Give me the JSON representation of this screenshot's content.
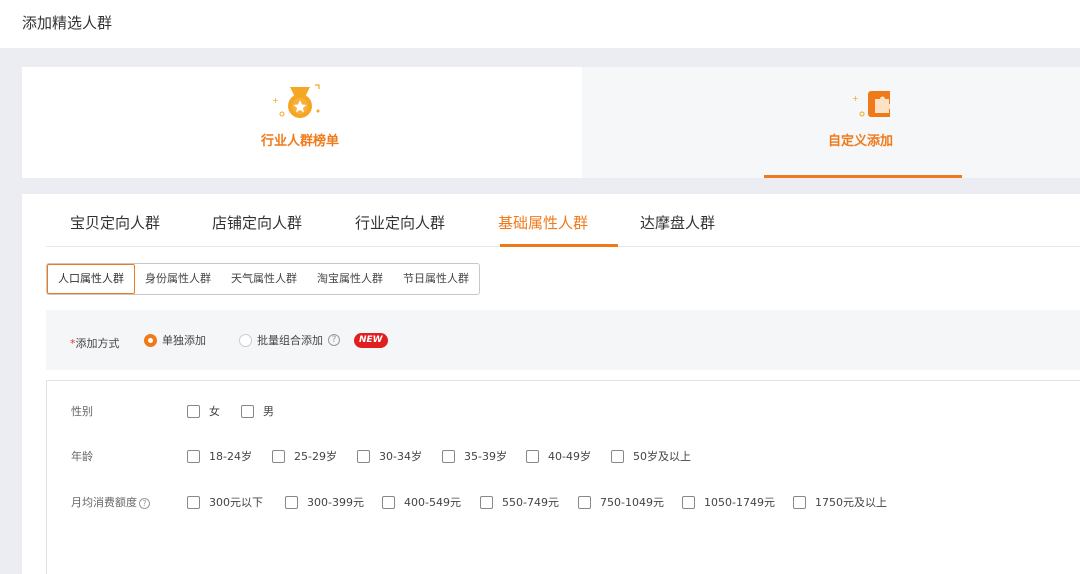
{
  "header": {
    "title": "添加精选人群"
  },
  "modes": [
    {
      "label": "行业人群榜单",
      "icon": "medal-icon"
    },
    {
      "label": "自定义添加",
      "icon": "puzzle-icon",
      "active": true
    }
  ],
  "tabs": [
    "宝贝定向人群",
    "店铺定向人群",
    "行业定向人群",
    "基础属性人群",
    "达摩盘人群"
  ],
  "active_tab": "基础属性人群",
  "subtabs": [
    "人口属性人群",
    "身份属性人群",
    "天气属性人群",
    "淘宝属性人群",
    "节日属性人群"
  ],
  "active_subtab": "人口属性人群",
  "method": {
    "required_mark": "*",
    "label": "添加方式",
    "options": [
      "单独添加",
      "批量组合添加"
    ],
    "selected": "单独添加",
    "help": "?",
    "badge": "NEW"
  },
  "filters": {
    "gender": {
      "label": "性别",
      "options": [
        "女",
        "男"
      ]
    },
    "age": {
      "label": "年龄",
      "options": [
        "18-24岁",
        "25-29岁",
        "30-34岁",
        "35-39岁",
        "40-49岁",
        "50岁及以上"
      ]
    },
    "spend": {
      "label": "月均消费额度",
      "help": "?",
      "options": [
        "300元以下",
        "300-399元",
        "400-549元",
        "550-749元",
        "750-1049元",
        "1050-1749元",
        "1750元及以上"
      ]
    }
  },
  "colors": {
    "accent": "#f07a1a",
    "badge": "#e02020"
  }
}
